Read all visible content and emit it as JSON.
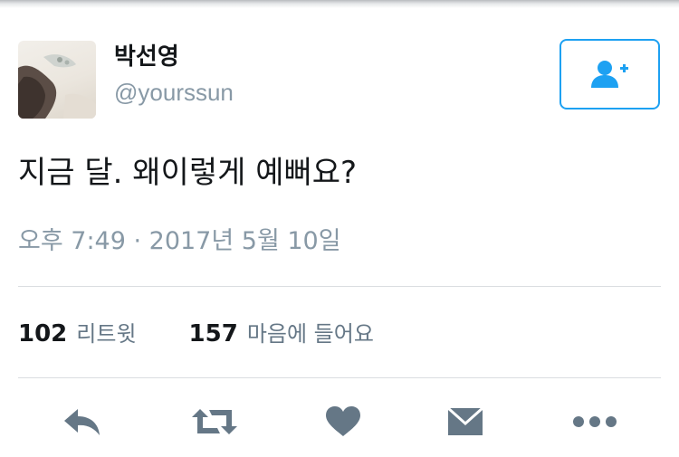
{
  "tweet": {
    "display_name": "박선영",
    "handle": "@yourssun",
    "text": "지금 달. 왜이렇게 예뻐요?",
    "timestamp": "오후 7:49 · 2017년 5월 10일"
  },
  "stats": {
    "retweets_count": "102",
    "retweets_label": "리트윗",
    "likes_count": "157",
    "likes_label": "마음에 들어요"
  },
  "icons": {
    "follow": "add-user-icon",
    "reply": "reply-icon",
    "retweet": "retweet-icon",
    "like": "heart-icon",
    "dm": "envelope-icon",
    "more": "more-dots-icon"
  },
  "colors": {
    "accent": "#1da1f2",
    "icon_gray": "#657786",
    "secondary_text": "#8899a6"
  }
}
